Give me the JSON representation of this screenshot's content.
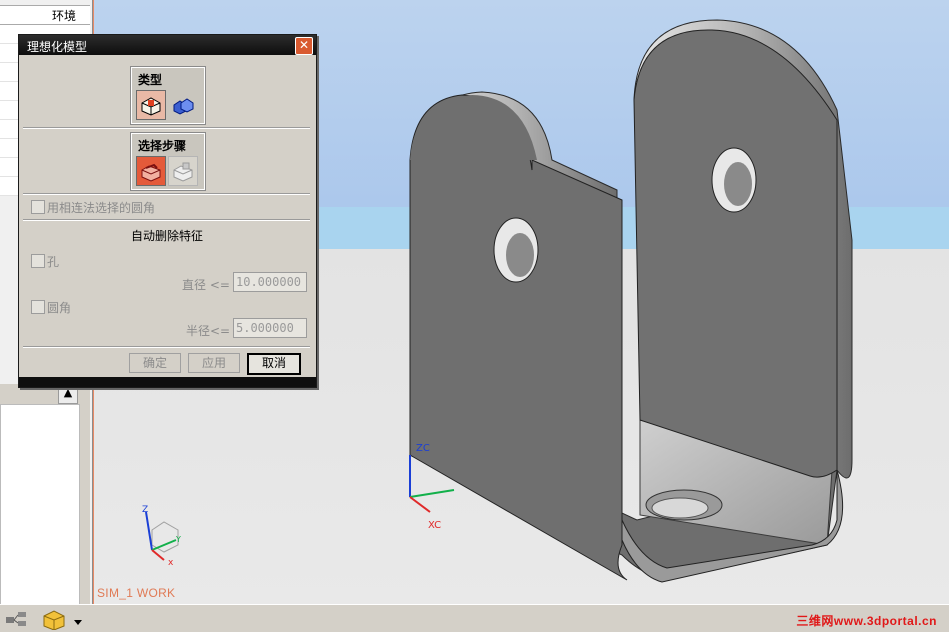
{
  "navigator": {
    "header_label": "环境"
  },
  "viewport": {
    "work_label": "SIM_1 WORK",
    "axis_zc": "ZC",
    "axis_xc": "XC",
    "triad_z": "Z",
    "triad_x": "x",
    "triad_y": "Y"
  },
  "dialog": {
    "title": "理想化模型",
    "type_group_label": "类型",
    "step_group_label": "选择步骤",
    "option_connected_fillets": "用相连法选择的圆角",
    "auto_delete_label": "自动删除特征",
    "hole_label": "孔",
    "diameter_label": "直径 <=",
    "diameter_value": "10.000000",
    "fillet_label": "圆角",
    "radius_label": "半径<=",
    "radius_value": "5.000000",
    "ok_label": "确定",
    "apply_label": "应用",
    "cancel_label": "取消"
  },
  "branding": {
    "text": "三维网www.3dportal.cn"
  },
  "colors": {
    "viewport_sky": "#a9c6ec",
    "floor": "#e6e6e6",
    "accent_orange": "#e07a55",
    "brand_red": "#e01818",
    "selected_button": "#e9b9a6"
  }
}
